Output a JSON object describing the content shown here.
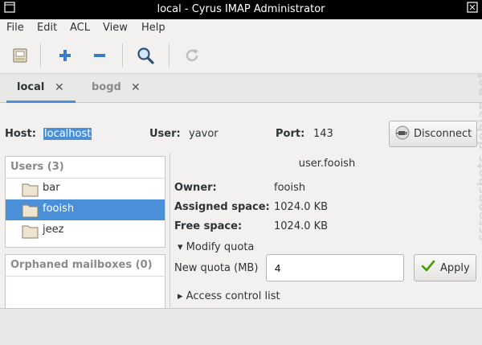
{
  "window": {
    "title": "local - Cyrus IMAP Administrator"
  },
  "menu": [
    "File",
    "Edit",
    "ACL",
    "View",
    "Help"
  ],
  "toolbar": {
    "icons": [
      "open-server-icon",
      "add-icon",
      "remove-icon",
      "search-icon",
      "refresh-icon"
    ]
  },
  "tabs": [
    {
      "label": "local",
      "active": true
    },
    {
      "label": "bogd",
      "active": false
    }
  ],
  "connection": {
    "host_label": "Host:",
    "host_value": "localhost",
    "user_label": "User:",
    "user_value": "yavor",
    "port_label": "Port:",
    "port_value": "143",
    "disconnect_label": "Disconnect"
  },
  "users": {
    "header": "Users (3)",
    "items": [
      {
        "name": "bar",
        "selected": false
      },
      {
        "name": "fooish",
        "selected": true
      },
      {
        "name": "jeez",
        "selected": false
      }
    ]
  },
  "orphaned": {
    "header": "Orphaned mailboxes (0)"
  },
  "mailbox": {
    "name": "user.fooish",
    "owner_label": "Owner:",
    "owner_value": "fooish",
    "assigned_label": "Assigned space:",
    "assigned_value": "1024.0 KB",
    "free_label": "Free space:",
    "free_value": "1024.0 KB"
  },
  "quota": {
    "expander_label": "Modify quota",
    "new_quota_label": "New quota (MB)",
    "new_quota_value": "4",
    "apply_label": "Apply"
  },
  "acl": {
    "expander_label": "Access control list"
  },
  "watermark": "screenshots.debian.net",
  "colors": {
    "accent": "#4a90d9",
    "titlebar": "#000000",
    "background": "#f2f1f0"
  }
}
